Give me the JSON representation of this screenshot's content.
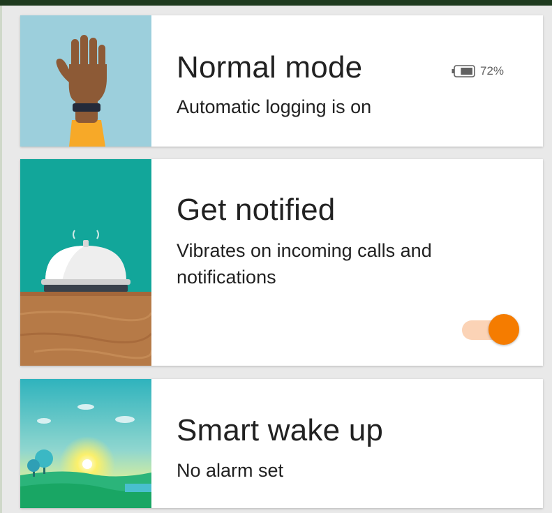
{
  "cards": [
    {
      "title": "Normal mode",
      "subtitle": "Automatic logging is on",
      "image_icon": "hand-wristband-icon"
    },
    {
      "title": "Get notified",
      "subtitle": "Vibrates on incoming calls and notifications",
      "image_icon": "service-bell-icon",
      "toggle": {
        "state": "on"
      }
    },
    {
      "title": "Smart wake up",
      "subtitle": "No alarm set",
      "image_icon": "sunrise-landscape-icon"
    }
  ],
  "battery": {
    "percent_text": "72%",
    "level": 0.72,
    "icon": "battery-icon"
  },
  "colors": {
    "accent": "#f57c00",
    "toggle_track": "#fbd3b6",
    "card_1_bg": "#9ccfdc",
    "card_2_bg": "#12a69a",
    "card_3_bg": "#3ab9c1"
  }
}
